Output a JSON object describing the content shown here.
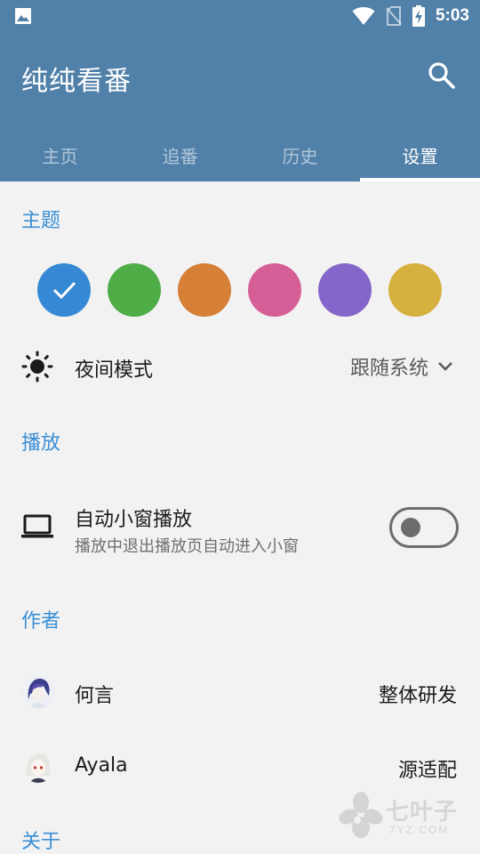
{
  "status_bar": {
    "time": "5:03",
    "icons": [
      "gallery-icon",
      "wifi-icon",
      "no-sim-icon",
      "battery-charging-icon"
    ]
  },
  "app_bar": {
    "title": "纯纯看番",
    "search_icon": "search-icon",
    "tabs": [
      {
        "label": "主页",
        "active": false
      },
      {
        "label": "追番",
        "active": false
      },
      {
        "label": "历史",
        "active": false
      },
      {
        "label": "设置",
        "active": true
      }
    ]
  },
  "settings": {
    "theme": {
      "header": "主题",
      "colors": [
        "#3589d4",
        "#4fad48",
        "#d57f37",
        "#d55e96",
        "#8465c9",
        "#d6b13f"
      ],
      "selected_index": 0
    },
    "night_mode": {
      "icon": "brightness-icon",
      "label": "夜间模式",
      "value": "跟随系统"
    },
    "playback": {
      "header": "播放",
      "auto_pip": {
        "icon": "laptop-icon",
        "label": "自动小窗播放",
        "description": "播放中退出播放页自动进入小窗",
        "enabled": false
      }
    },
    "authors": {
      "header": "作者",
      "items": [
        {
          "name": "何言",
          "role": "整体研发"
        },
        {
          "name": "Ayala",
          "role": "源适配"
        }
      ]
    },
    "about": {
      "header": "关于"
    }
  },
  "watermark": {
    "text": "七叶子",
    "domain": "7YZ.COM"
  },
  "colors": {
    "primary": "#5180a9",
    "accent": "#3a8fd6",
    "background": "#f2f2f2"
  }
}
